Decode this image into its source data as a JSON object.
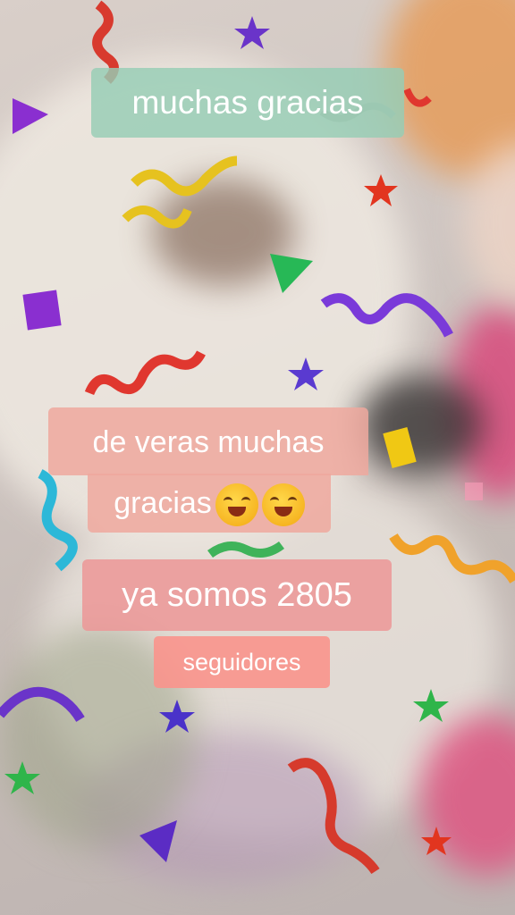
{
  "captions": {
    "line1": "muchas gracias",
    "line2a": "de veras muchas",
    "line2b": "gracias",
    "line3": "ya somos 2805",
    "line4": "seguidores"
  },
  "emojis": [
    "laughing-face-emoji",
    "grinning-face-emoji"
  ],
  "colors": {
    "caption_green": "#96cdb4",
    "caption_pink": "#eea89e",
    "caption_salmon": "#fa948c",
    "caption_text": "#ffffff"
  }
}
